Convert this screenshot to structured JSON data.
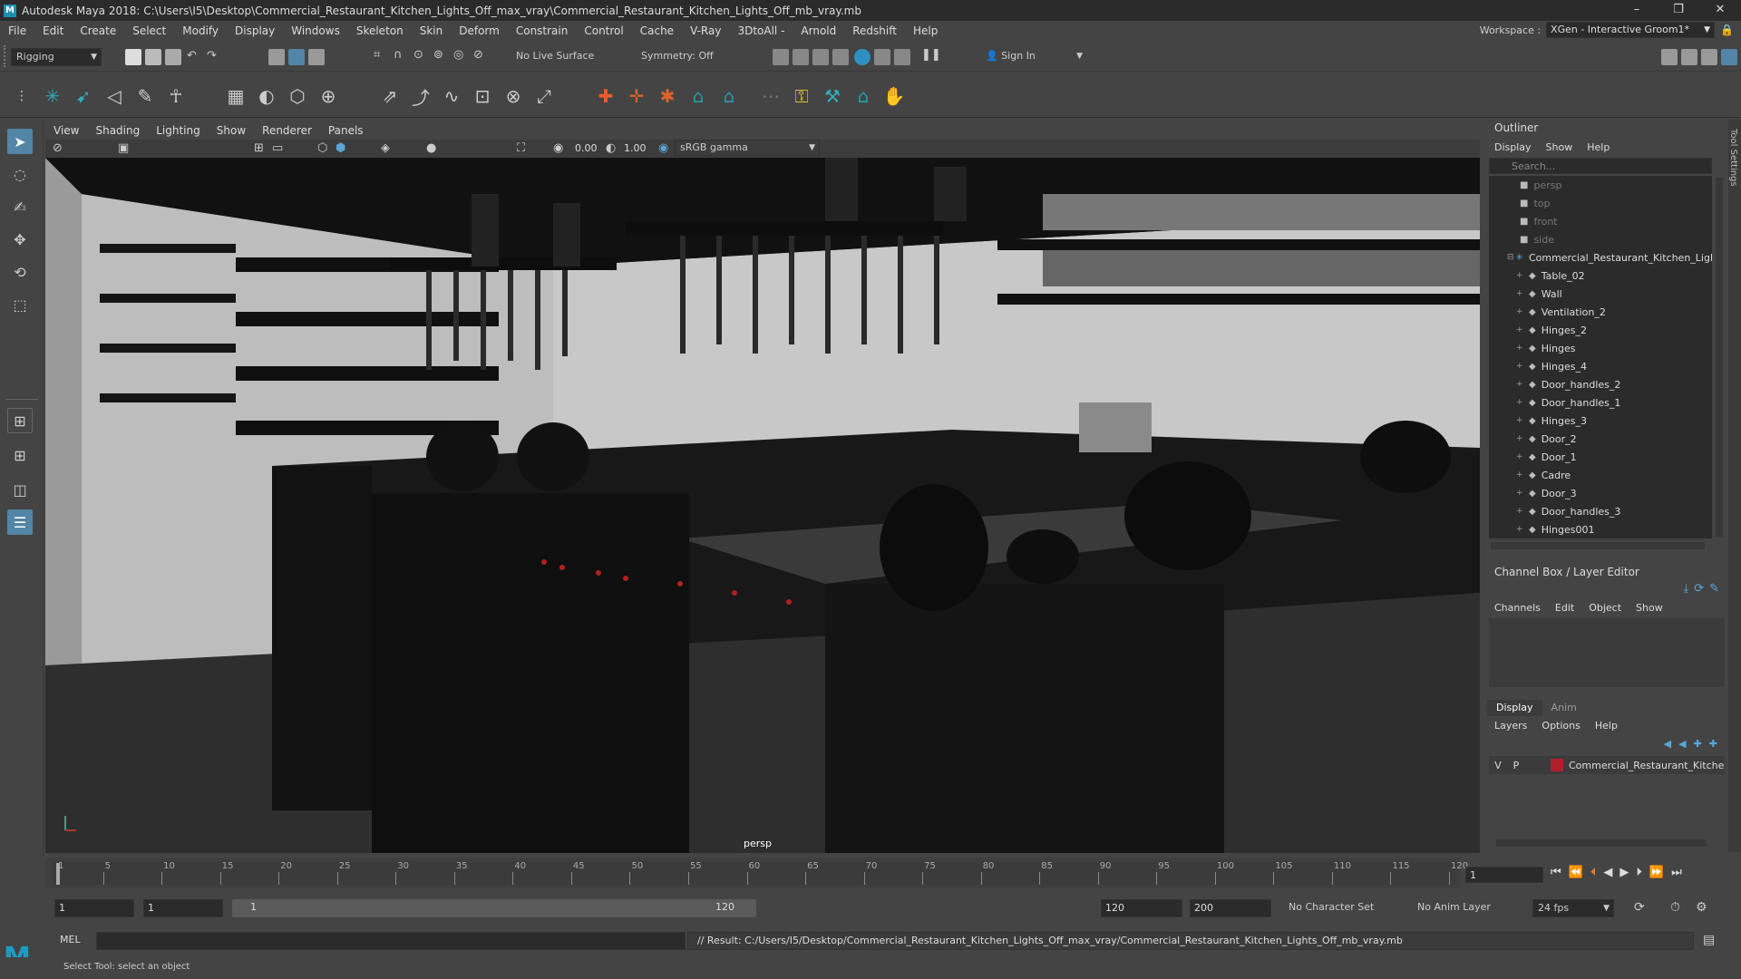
{
  "window": {
    "title": "Autodesk Maya 2018: C:\\Users\\I5\\Desktop\\Commercial_Restaurant_Kitchen_Lights_Off_max_vray\\Commercial_Restaurant_Kitchen_Lights_Off_mb_vray.mb",
    "logo": "M"
  },
  "menubar": [
    "File",
    "Edit",
    "Create",
    "Select",
    "Modify",
    "Display",
    "Windows",
    "Skeleton",
    "Skin",
    "Deform",
    "Constrain",
    "Control",
    "Cache",
    "V-Ray",
    "3DtoAll -",
    "Arnold",
    "Redshift",
    "Help"
  ],
  "workspace": {
    "label": "Workspace :",
    "value": "XGen - Interactive Groom1*"
  },
  "statusline": {
    "menuset": "Rigging",
    "live_surface": "No Live Surface",
    "symmetry": "Symmetry: Off",
    "sign_in": "Sign In"
  },
  "panel": {
    "menus": [
      "View",
      "Shading",
      "Lighting",
      "Show",
      "Renderer",
      "Panels"
    ],
    "exposure": "0.00",
    "gamma": "1.00",
    "color_space": "sRGB gamma",
    "camera_label": "persp"
  },
  "outliner": {
    "title": "Outliner",
    "menus": [
      "Display",
      "Show",
      "Help"
    ],
    "search_placeholder": "Search...",
    "items": [
      {
        "label": "persp",
        "kind": "camera"
      },
      {
        "label": "top",
        "kind": "camera"
      },
      {
        "label": "front",
        "kind": "camera"
      },
      {
        "label": "side",
        "kind": "camera"
      },
      {
        "label": "Commercial_Restaurant_Kitchen_Ligh",
        "kind": "root"
      },
      {
        "label": "Table_02",
        "kind": "mesh"
      },
      {
        "label": "Wall",
        "kind": "mesh"
      },
      {
        "label": "Ventilation_2",
        "kind": "mesh"
      },
      {
        "label": "Hinges_2",
        "kind": "mesh"
      },
      {
        "label": "Hinges",
        "kind": "mesh"
      },
      {
        "label": "Hinges_4",
        "kind": "mesh"
      },
      {
        "label": "Door_handles_2",
        "kind": "mesh"
      },
      {
        "label": "Door_handles_1",
        "kind": "mesh"
      },
      {
        "label": "Hinges_3",
        "kind": "mesh"
      },
      {
        "label": "Door_2",
        "kind": "mesh"
      },
      {
        "label": "Door_1",
        "kind": "mesh"
      },
      {
        "label": "Cadre",
        "kind": "mesh"
      },
      {
        "label": "Door_3",
        "kind": "mesh"
      },
      {
        "label": "Door_handles_3",
        "kind": "mesh"
      },
      {
        "label": "Hinges001",
        "kind": "mesh"
      }
    ]
  },
  "channelbox": {
    "title": "Channel Box / Layer Editor",
    "menus": [
      "Channels",
      "Edit",
      "Object",
      "Show"
    ],
    "tabs": [
      "Display",
      "Anim"
    ],
    "layer_menus": [
      "Layers",
      "Options",
      "Help"
    ],
    "layer": {
      "v": "V",
      "p": "P",
      "name": "Commercial_Restaurant_Kitche",
      "color": "#b0202c"
    }
  },
  "timeline": {
    "ticks": [
      "1",
      "5",
      "10",
      "15",
      "20",
      "25",
      "30",
      "35",
      "40",
      "45",
      "50",
      "55",
      "60",
      "65",
      "70",
      "75",
      "80",
      "85",
      "90",
      "95",
      "100",
      "105",
      "110",
      "115",
      "120"
    ],
    "current_frame": "1"
  },
  "range": {
    "start": "1",
    "anim_start": "1",
    "slider_start": "1",
    "slider_end": "120",
    "end": "120",
    "anim_end": "200",
    "character_set": "No Character Set",
    "anim_layer": "No Anim Layer",
    "fps": "24 fps"
  },
  "command": {
    "label": "MEL",
    "result": "// Result: C:/Users/I5/Desktop/Commercial_Restaurant_Kitchen_Lights_Off_max_vray/Commercial_Restaurant_Kitchen_Lights_Off_mb_vray.mb"
  },
  "helpline": {
    "text": "Select Tool: select an object"
  },
  "right_strip": {
    "label": "Tool Settings"
  },
  "colors": {
    "accent": "#5285a6",
    "bg": "#444444",
    "dark": "#2b2b2b"
  }
}
